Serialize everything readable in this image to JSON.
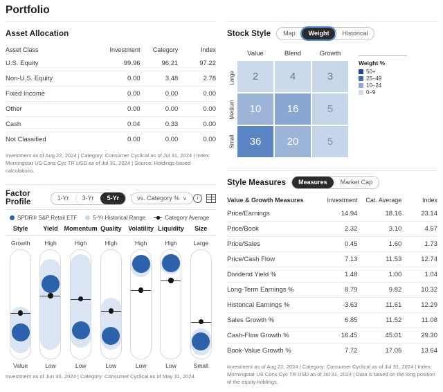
{
  "page": {
    "title": "Portfolio"
  },
  "asset_allocation": {
    "title": "Asset Allocation",
    "columns": [
      "Asset Class",
      "Investment",
      "Category",
      "Index"
    ],
    "rows": [
      {
        "label": "U.S. Equity",
        "investment": "99.96",
        "category": "96.21",
        "index": "97.22"
      },
      {
        "label": "Non-U.S. Equity",
        "investment": "0.00",
        "category": "3.48",
        "index": "2.78"
      },
      {
        "label": "Fixed Income",
        "investment": "0.00",
        "category": "0.00",
        "index": "0.00"
      },
      {
        "label": "Other",
        "investment": "0.00",
        "category": "0.00",
        "index": "0.00"
      },
      {
        "label": "Cash",
        "investment": "0.04",
        "category": "0.33",
        "index": "0.00"
      },
      {
        "label": "Not Classified",
        "investment": "0.00",
        "category": "0.00",
        "index": "0.00"
      }
    ],
    "footnote": "Investment as of Aug 22, 2024 | Category: Consumer Cyclical as of Jul 31, 2024 | Index: Morningstar US Cons Cyc TR USD as of Jul 31, 2024 | Source: Holdings-based calculations."
  },
  "stock_style": {
    "title": "Stock Style",
    "tabs": [
      {
        "label": "Map",
        "active": false
      },
      {
        "label": "Weight",
        "active": true
      },
      {
        "label": "Historical",
        "active": false
      }
    ],
    "col_labels": [
      "Value",
      "Blend",
      "Growth"
    ],
    "row_labels": [
      "Large",
      "Medium",
      "Small"
    ],
    "legend_title": "Weight %",
    "legend": [
      {
        "label": "50+",
        "color": "#1b4b96"
      },
      {
        "label": "25–49",
        "color": "#3f6cb0"
      },
      {
        "label": "10–24",
        "color": "#8fa9d4"
      },
      {
        "label": "0–9",
        "color": "#cfdcef"
      }
    ],
    "chart_data": {
      "type": "heatmap",
      "title": "Stock Style — Weight %",
      "xlabel": "",
      "ylabel": "",
      "x_categories": [
        "Value",
        "Blend",
        "Growth"
      ],
      "y_categories": [
        "Large",
        "Medium",
        "Small"
      ],
      "values": [
        [
          2,
          4,
          3
        ],
        [
          10,
          16,
          5
        ],
        [
          36,
          20,
          5
        ]
      ],
      "cell_colors": [
        [
          "#ccd9ec",
          "#ccd9ec",
          "#c9d7ea"
        ],
        [
          "#9cb4d8",
          "#8aa7d1",
          "#c6d5e9"
        ],
        [
          "#5b84c4",
          "#9cb4d8",
          "#c6d5e9"
        ]
      ],
      "text_colors": [
        [
          "#6b7a8c",
          "#6b7a8c",
          "#6b7a8c"
        ],
        [
          "#ffffff",
          "#ffffff",
          "#7f8fa3"
        ],
        [
          "#ffffff",
          "#ffffff",
          "#7f8fa3"
        ]
      ],
      "legend_position": "right",
      "legend_bins": [
        "50+",
        "25–49",
        "10–24",
        "0–9"
      ]
    }
  },
  "factor_profile": {
    "title": "Factor Profile",
    "period_tabs": [
      {
        "label": "1-Yr",
        "active": false
      },
      {
        "label": "3-Yr",
        "active": false
      },
      {
        "label": "5-Yr",
        "active": true
      }
    ],
    "comparison": "vs. Category %",
    "caret": "∨",
    "info_icon": "ⓘ",
    "legend": [
      {
        "label": "SPDR® S&P Retail ETF",
        "color": "#2b62ab",
        "marker": "dot"
      },
      {
        "label": "5-Yr Historical Range",
        "color": "#c9d7ea",
        "marker": "dot"
      },
      {
        "label": "Category Average",
        "color": "#1a1a1a",
        "marker": "line-dot"
      }
    ],
    "footnote": "Investment as of Jun 30, 2024 | Category: Consumer Cyclical as of May 31, 2024",
    "chart_data": {
      "type": "scatter",
      "title": "Factor Profile — 5-Yr vs. Category %",
      "xlabel": "",
      "ylabel": "Percentile (top = high)",
      "categories": [
        "Style",
        "Yield",
        "Momentum",
        "Quality",
        "Volatility",
        "Liquidity",
        "Size"
      ],
      "top_labels": [
        "Growth",
        "High",
        "High",
        "High",
        "High",
        "High",
        "Large"
      ],
      "bottom_labels": [
        "Value",
        "Low",
        "Low",
        "Low",
        "Low",
        "Low",
        "Small"
      ],
      "series": [
        {
          "name": "SPDR® S&P Retail ETF",
          "values_pct_from_top": [
            76,
            31,
            74,
            79,
            13,
            12,
            84
          ]
        },
        {
          "name": "Category Average",
          "values_pct_from_top": [
            58,
            42,
            45,
            56,
            37,
            28,
            66
          ]
        }
      ],
      "historical_range": [
        {
          "factor": "Style",
          "top_pct": 52,
          "bottom_pct": 95
        },
        {
          "factor": "Yield",
          "top_pct": 8,
          "bottom_pct": 92
        },
        {
          "factor": "Momentum",
          "top_pct": 4,
          "bottom_pct": 90
        },
        {
          "factor": "Quality",
          "top_pct": 44,
          "bottom_pct": 92
        },
        {
          "factor": "Volatility",
          "top_pct": 5,
          "bottom_pct": 25
        },
        {
          "factor": "Liquidity",
          "top_pct": 3,
          "bottom_pct": 22
        },
        {
          "factor": "Size",
          "top_pct": 72,
          "bottom_pct": 97
        }
      ]
    }
  },
  "style_measures": {
    "title": "Style Measures",
    "tabs": [
      {
        "label": "Measures",
        "active": true
      },
      {
        "label": "Market Cap",
        "active": false
      }
    ],
    "columns": [
      "Value & Growth Measures",
      "Investment",
      "Cat. Average",
      "Index"
    ],
    "rows": [
      {
        "label": "Price/Earnings",
        "investment": "14.94",
        "cat_average": "18.16",
        "index": "23.14"
      },
      {
        "label": "Price/Book",
        "investment": "2.32",
        "cat_average": "3.10",
        "index": "4.57"
      },
      {
        "label": "Price/Sales",
        "investment": "0.45",
        "cat_average": "1.60",
        "index": "1.73"
      },
      {
        "label": "Price/Cash Flow",
        "investment": "7.13",
        "cat_average": "11.53",
        "index": "12.74"
      },
      {
        "label": "Dividend Yield %",
        "investment": "1.48",
        "cat_average": "1.00",
        "index": "1.04"
      },
      {
        "label": "Long-Term Earnings %",
        "investment": "8.79",
        "cat_average": "9.82",
        "index": "10.32"
      },
      {
        "label": "Historical Earnings %",
        "investment": "-3.63",
        "cat_average": "11.61",
        "index": "12.29"
      },
      {
        "label": "Sales Growth %",
        "investment": "6.85",
        "cat_average": "11.52",
        "index": "11.08"
      },
      {
        "label": "Cash-Flow Growth %",
        "investment": "16.45",
        "cat_average": "45.01",
        "index": "29.30"
      },
      {
        "label": "Book-Value Growth %",
        "investment": "7.72",
        "cat_average": "17.05",
        "index": "13.64"
      }
    ],
    "footnote": "Investment as of Aug 22, 2024 | Category: Consumer Cyclical as of Jul 31, 2024 | Index: Morningstar US Cons Cyc TR USD as of Jul 31, 2024 | Data is based on the long position of the equity holdings."
  }
}
